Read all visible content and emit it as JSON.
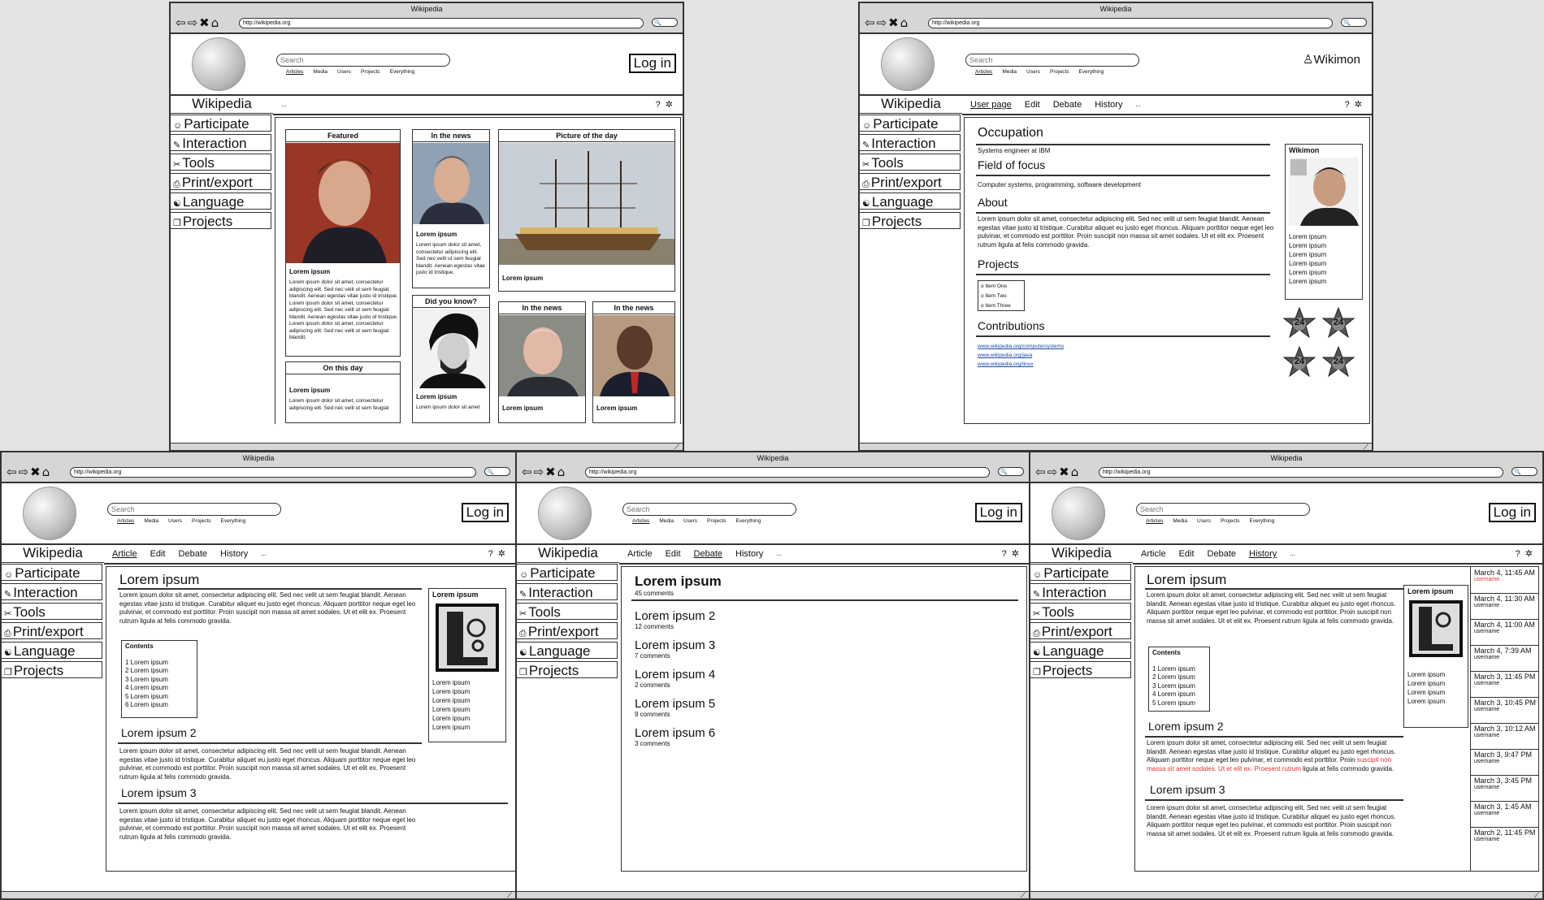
{
  "browser": {
    "title": "Wikipedia",
    "url": "http://wikipedia.org",
    "nav_glyphs": "⇦⇨✖⌂",
    "search_glyph": "🔍"
  },
  "common": {
    "logo": "Wikipedia",
    "search_placeholder": "Search",
    "search_tabs": [
      "Articles",
      "Media",
      "Users",
      "Projects",
      "Everything"
    ],
    "login": "Log in",
    "sidebar_title": "Wikipedia",
    "sidebar": [
      {
        "icon": "participate-icon",
        "glyph": "☺",
        "label": "Participate"
      },
      {
        "icon": "interaction-icon",
        "glyph": "✎",
        "label": "Interaction"
      },
      {
        "icon": "tools-icon",
        "glyph": "✂",
        "label": "Tools"
      },
      {
        "icon": "print-icon",
        "glyph": "⎙",
        "label": "Print/export"
      },
      {
        "icon": "language-icon",
        "glyph": "☯",
        "label": "Language"
      },
      {
        "icon": "projects-icon",
        "glyph": "❐",
        "label": "Projects"
      }
    ],
    "help_glyph": "?",
    "settings_glyph": "✲",
    "ellipsis": "..."
  },
  "home": {
    "featured": {
      "title": "Featured",
      "subtitle": "Lorem ipsum",
      "text": "Lorem ipsum dolor sit amet, consectetur adipiscing elit. Sed nec velit ut sem feugiat blandit. Aenean egestas vitae justo id tristique. Lorem ipsum dolor sit amet, consectetur adipiscing elit. Sed nec velit ut sem feugiat blandit. Aenean egestas vitae justo id tristique. Lorem ipsum dolor sit amet, consectetur adipiscing elit. Sed nec velit ut sem feugiat blandit."
    },
    "on_this_day": {
      "title": "On this day",
      "subtitle": "Lorem ipsum",
      "text": "Lorem ipsum dolor sit amet, consectetur adipiscing elit. Sed nec velit ut sem feugiat"
    },
    "news1": {
      "title": "In the news",
      "subtitle": "Lorem ipsum",
      "text": "Lorem ipsum dolor sit amet, consectetur adipiscing elit. Sed nec velit ut sem feugiat blandit. Aenean egestas vitae justo id tristique."
    },
    "dyk": {
      "title": "Did you know?",
      "subtitle": "Lorem ipsum",
      "text": "Lorem ipsum dolor sit amet"
    },
    "potd": {
      "title": "Picture of the day",
      "subtitle": "Lorem ipsum"
    },
    "news2": {
      "title": "In the news",
      "subtitle": "Lorem ipsum"
    },
    "news3": {
      "title": "In the news",
      "subtitle": "Lorem ipsum"
    }
  },
  "user": {
    "username": "Wikimon",
    "user_glyph": "♙",
    "tabs": [
      "User page",
      "Edit",
      "Debate",
      "History"
    ],
    "occupation_h": "Occupation",
    "occupation": "Systems engineer at IBM",
    "focus_h": "Field of focus",
    "focus": "Computer systems, programming, software development",
    "about_h": "About",
    "about": "Lorem ipsum dolor sit amet, consectetur adipiscing elit. Sed nec velit ut sem feugiat blandit. Aenean egestas vitae justo id tristique. Curabitur aliquet eu justo eget rhoncus. Aliquam porttitor neque eget leo pulvinar, et commodo est porttitor. Proin suscipit non massa sit amet sodales. Ut et elit ex. Proesent rutrum ligula at felis commodo gravida.",
    "projects_h": "Projects",
    "projects": [
      "o Item One",
      "o Item Two",
      "o Item Three"
    ],
    "contrib_h": "Contributions",
    "contrib": [
      "www.wikipedia.org/computersystems",
      "www.wikipedia.org/java",
      "www.wikipedia.org/linux"
    ],
    "card_title": "Wikimon",
    "card_lines": [
      "Lorem ipsum",
      "Lorem ipsum",
      "Lorem ipsum",
      "Lorem ipsum",
      "Lorem ipsum",
      "Lorem ipsum"
    ],
    "badge_text": "24"
  },
  "article": {
    "tabs": [
      "Article",
      "Edit",
      "Debate",
      "History"
    ],
    "h1": "Lorem ipsum",
    "p1": "Lorem ipsum dolor sit amet, consectetur adipiscing elit. Sed nec velit ut sem feugiat blandit. Aenean egestas vitae justo id tristique. Curabitur aliquet eu justo eget rhoncus. Aliquam porttitor neque eget leo pulvinar, et commodo est porttitor. Proin suscipit non massa sit amet sodales. Ut et elit ex. Proesent rutrum ligula at felis commodo gravida.",
    "contents_title": "Contents",
    "contents": [
      "1 Lorem ipsum",
      "2 Lorem ipsum",
      "3 Lorem ipsum",
      "4 Lorem ipsum",
      "5 Lorem ipsum",
      "6 Lorem ipsum"
    ],
    "h2": "Lorem ipsum 2",
    "p2": "Lorem ipsum dolor sit amet, consectetur adipiscing elit. Sed nec velit ut sem feugiat blandit. Aenean egestas vitae justo id tristique. Curabitur aliquet eu justo eget rhoncus. Aliquam porttitor neque eget leo pulvinar, et commodo est porttitor. Proin suscipit non massa sit amet sodales. Ut et elit ex. Proesent rutrum ligula at felis commodo gravida.",
    "h3": "Lorem ipsum 3",
    "p3": "Lorem ipsum dolor sit amet, consectetur adipiscing elit. Sed nec velit ut sem feugiat blandit. Aenean egestas vitae justo id tristique. Curabitur aliquet eu justo eget rhoncus. Aliquam porttitor neque eget leo pulvinar, et commodo est porttitor. Proin suscipit non massa sit amet sodales. Ut et elit ex. Proesent rutrum ligula at felis commodo gravida.",
    "infobox_title": "Lorem ipsum",
    "infobox_lines": [
      "Lorem ipsum",
      "Lorem ipsum",
      "Lorem ipsum",
      "Lorem ipsum",
      "Lorem ipsum",
      "Lorem ipsum"
    ]
  },
  "debate": {
    "tabs": [
      "Article",
      "Edit",
      "Debate",
      "History"
    ],
    "topics": [
      {
        "title": "Lorem ipsum",
        "comments": "45 comments"
      },
      {
        "title": "Lorem ipsum 2",
        "comments": "12 comments"
      },
      {
        "title": "Lorem ipsum 3",
        "comments": "7 comments"
      },
      {
        "title": "Lorem ipsum 4",
        "comments": "2 comments"
      },
      {
        "title": "Lorem ipsum 5",
        "comments": "9 comments"
      },
      {
        "title": "Lorem ipsum 6",
        "comments": "3 comments"
      }
    ]
  },
  "history": {
    "tabs": [
      "Article",
      "Edit",
      "Debate",
      "History"
    ],
    "h1": "Lorem ipsum",
    "p1": "Lorem ipsum dolor sit amet, consectetur adipiscing elit. Sed nec velit ut sem feugiat blandit. Aenean egestas vitae justo id tristique. Curabitur aliquet eu justo eget rhoncus. Aliquam porttitor neque eget leo pulvinar, et commodo est porttitor. Proin suscipit non massa sit amet sodales. Ut et elit ex. Proesent rutrum ligula at felis commodo gravida.",
    "contents_title": "Contents",
    "contents": [
      "1 Lorem ipsum",
      "2 Lorem ipsum",
      "3 Lorem ipsum",
      "4 Lorem ipsum",
      "5 Lorem ipsum"
    ],
    "h2": "Lorem ipsum 2",
    "p2_a": "Lorem ipsum dolor sit amet, consectetur adipiscing elit. Sed nec velit ut sem feugiat blandit. Aenean egestas vitae justo id tristique. Curabitur aliquet eu justo eget rhoncus. Aliquam porttitor neque eget leo pulvinar, et commodo est porttitor. Proin",
    "p2_red": "suscipit non massa sit amet sodales. Ut et elit ex. Proesent rutrum",
    "p2_b": "ligula at felis commodo gravida.",
    "h3": "Lorem ipsum 3",
    "p3": "Lorem ipsum dolor sit amet, consectetur adipiscing elit. Sed nec velit ut sem feugiat blandit. Aenean egestas vitae justo id tristique. Curabitur aliquet eu justo eget rhoncus. Aliquam porttitor neque eget leo pulvinar, et commodo est porttitor. Proin suscipit non massa sit amet sodales. Ut et elit ex. Proesent rutrum ligula at felis commodo gravida.",
    "infobox_title": "Lorem ipsum",
    "infobox_lines": [
      "Lorem ipsum",
      "Lorem ipsum",
      "Lorem ipsum",
      "Lorem ipsum"
    ],
    "revisions": [
      {
        "time": "March 4, 11:45 AM",
        "user": "username",
        "red": true
      },
      {
        "time": "March 4, 11:30 AM",
        "user": "username",
        "red": false
      },
      {
        "time": "March 4, 11:00 AM",
        "user": "username",
        "red": false
      },
      {
        "time": "March 4, 7:39 AM",
        "user": "username",
        "red": false
      },
      {
        "time": "March 3, 11:45 PM",
        "user": "username",
        "red": false
      },
      {
        "time": "March 3, 10:45 PM",
        "user": "username",
        "red": false
      },
      {
        "time": "March 3, 10:12 AM",
        "user": "username",
        "red": false
      },
      {
        "time": "March 3, 9:47 PM",
        "user": "username",
        "red": false
      },
      {
        "time": "March 3, 3:45 PM",
        "user": "username",
        "red": false
      },
      {
        "time": "March 3, 1:45 AM",
        "user": "username",
        "red": false
      },
      {
        "time": "March 2, 11:45 PM",
        "user": "username",
        "red": false
      }
    ]
  },
  "colors": {
    "link": "#1a4aa8",
    "highlight": "#e53131",
    "chrome": "#d6d6d6"
  }
}
